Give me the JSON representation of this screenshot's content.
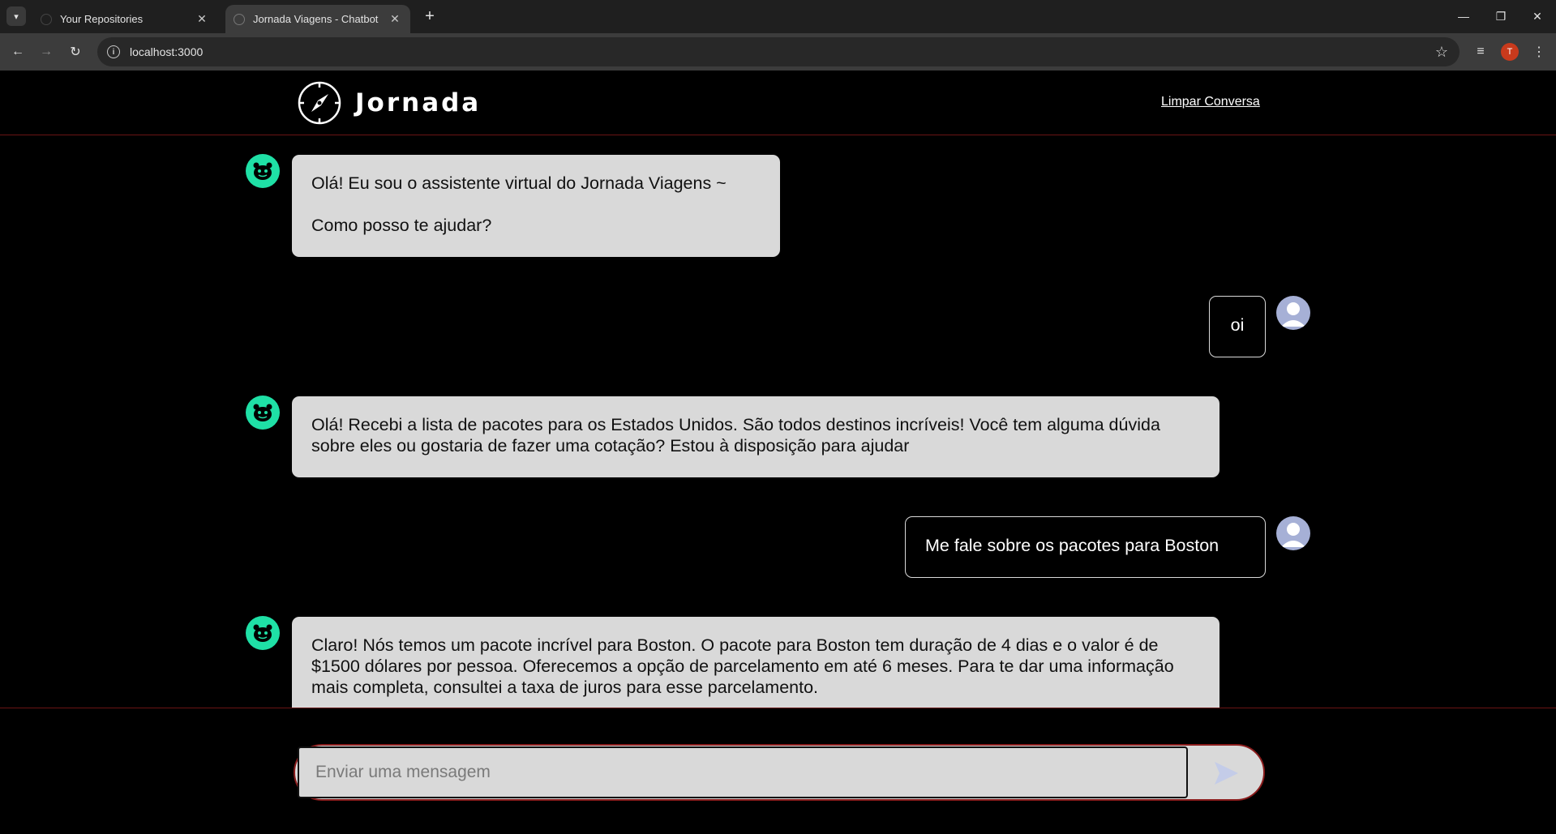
{
  "browser": {
    "tabs": [
      {
        "title": "Your Repositories",
        "close": "✕"
      },
      {
        "title": "Jornada Viagens - Chatbot",
        "close": "✕"
      }
    ],
    "new_tab": "+",
    "url": "localhost:3000",
    "profile_initial": "T",
    "icons": {
      "back": "back-arrow-icon",
      "forward": "forward-arrow-icon",
      "reload": "reload-icon",
      "bookmark": "star-icon"
    }
  },
  "header": {
    "brand": "Jornada",
    "clear_link": "Limpar Conversa"
  },
  "messages": [
    {
      "role": "bot",
      "lines": [
        "Olá! Eu sou o assistente virtual do Jornada Viagens ~",
        "Como posso te ajudar?"
      ]
    },
    {
      "role": "user",
      "text": "oi"
    },
    {
      "role": "bot",
      "text": "Olá! Recebi a lista de pacotes para os Estados Unidos. São todos destinos incríveis! Você tem alguma dúvida sobre eles ou gostaria de fazer uma cotação? Estou à disposição para ajudar"
    },
    {
      "role": "user",
      "text": "Me fale sobre os pacotes para Boston"
    },
    {
      "role": "bot",
      "text": "Claro! Nós temos um pacote incrível para Boston. O pacote para Boston tem duração de 4 dias e o valor é de $1500 dólares por pessoa. Oferecemos a opção de parcelamento em até 6 meses. Para te dar uma informação mais completa, consultei a taxa de juros para esse parcelamento."
    }
  ],
  "composer": {
    "placeholder": "Enviar uma mensagem"
  },
  "colors": {
    "bot_avatar": "#1fe0a6",
    "bubble_bot": "#d9d9d9",
    "divider": "#6a1414",
    "send_icon": "#c4cce8"
  }
}
